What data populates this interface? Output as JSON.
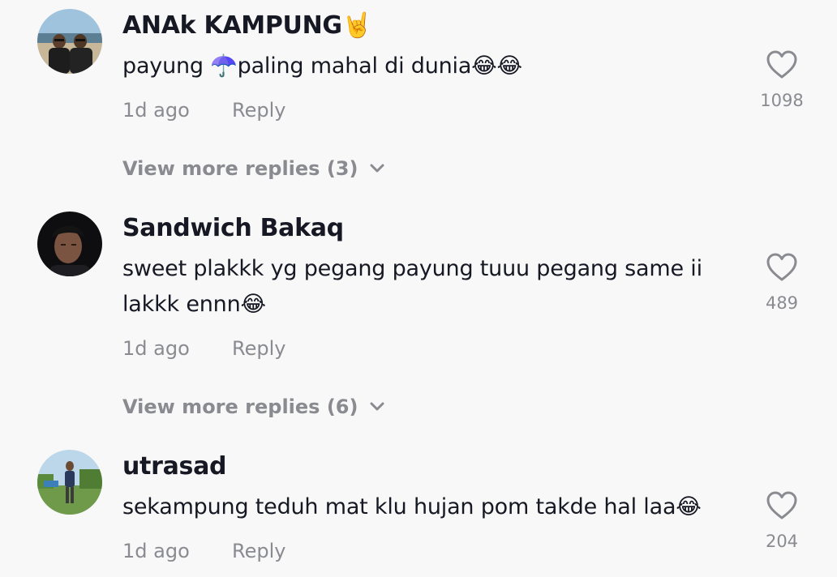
{
  "comments": [
    {
      "username": "ANAk KAMPUNG🤘",
      "text": "payung ☂️paling mahal di dunia😂😂",
      "time": "1d ago",
      "reply_label": "Reply",
      "likes": "1098",
      "more_replies": "View more replies (3)"
    },
    {
      "username": "Sandwich Bakaq",
      "text": "sweet plakkk yg pegang payung tuuu pegang same ii lakkk ennn😂",
      "time": "1d ago",
      "reply_label": "Reply",
      "likes": "489",
      "more_replies": "View more replies (6)"
    },
    {
      "username": "utrasad",
      "text": "sekampung teduh mat klu hujan pom takde hal laa😂",
      "time": "1d ago",
      "reply_label": "Reply",
      "likes": "204"
    }
  ],
  "icons": {
    "like": "heart-outline-icon",
    "expand": "chevron-down-icon"
  },
  "colors": {
    "background": "#f8f8f8",
    "primary_text": "#161823",
    "secondary_text": "#8a8b91"
  }
}
